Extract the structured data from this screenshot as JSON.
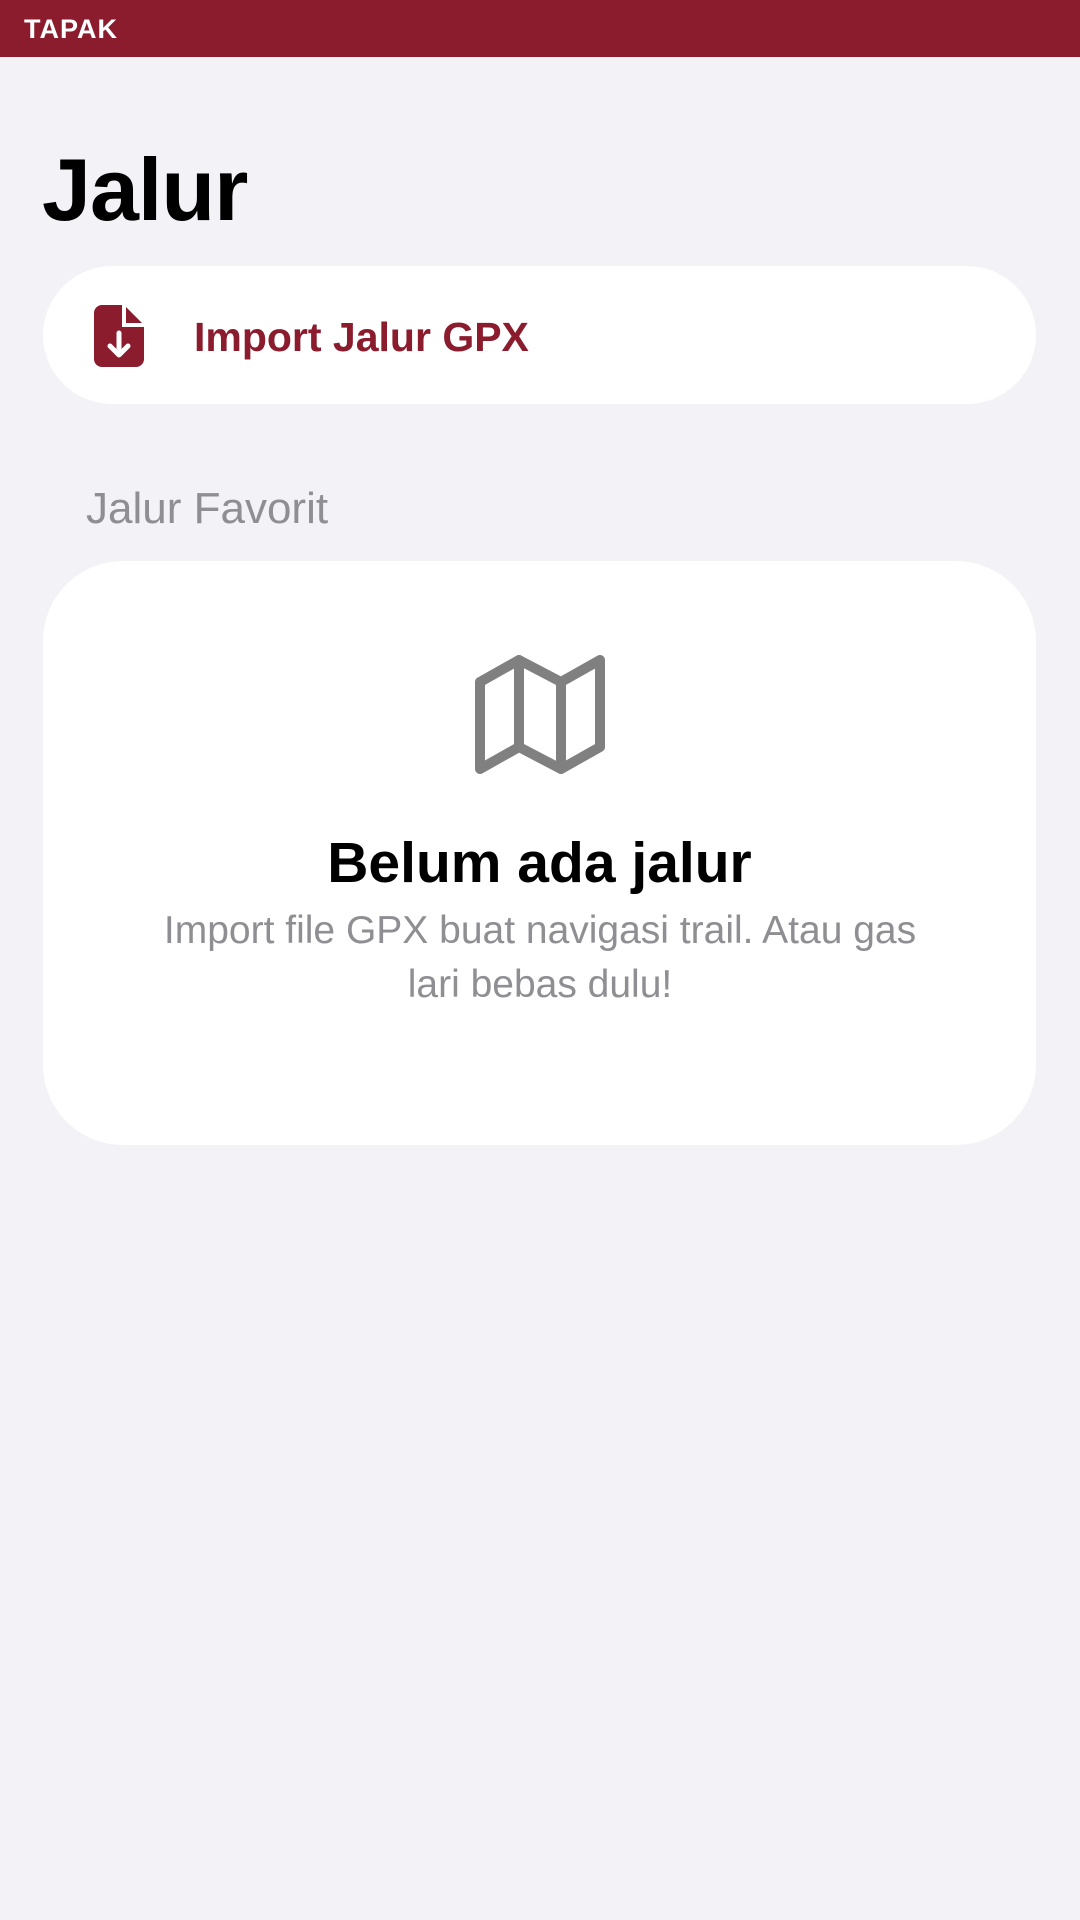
{
  "app": {
    "brand": "TAPAK"
  },
  "header": {
    "title": "Jalur"
  },
  "import": {
    "label": "Import Jalur GPX",
    "icon": "file-download-icon"
  },
  "favorites": {
    "section_label": "Jalur Favorit",
    "empty_state": {
      "icon": "map-icon",
      "title": "Belum ada jalur",
      "subtitle": "Import file GPX buat navigasi trail. Atau gas lari bebas dulu!"
    }
  },
  "colors": {
    "accent": "#8B1C2E",
    "background": "#F2F2F7",
    "secondary_text": "#8E8E93",
    "card": "#FFFFFF",
    "icon_gray": "#808080"
  }
}
